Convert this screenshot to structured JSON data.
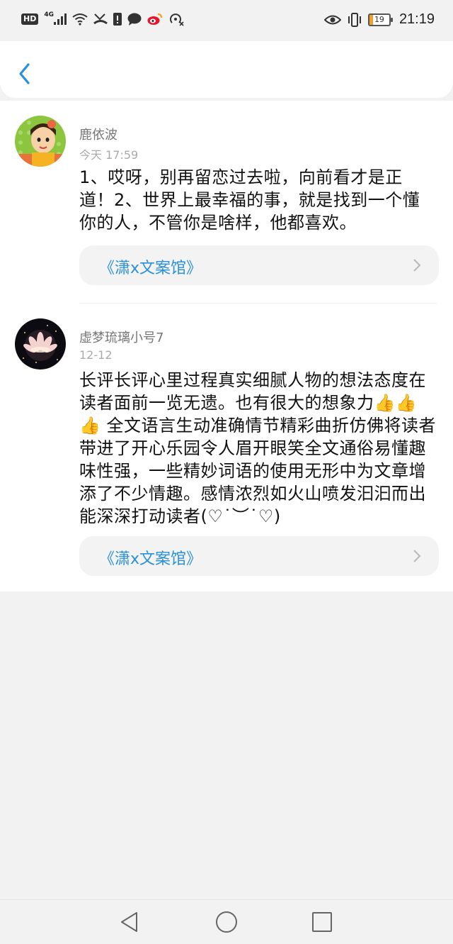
{
  "status_bar": {
    "hd": "HD",
    "network": "4G",
    "battery": "19",
    "battery_level": 0.19,
    "time": "21:19",
    "icons": [
      "hd-icon",
      "signal-icon",
      "wifi-icon",
      "missed-call-icon",
      "alert-icon",
      "message-icon",
      "weibo-icon",
      "hotspot-icon",
      "eye-icon",
      "vibrate-icon",
      "battery-icon"
    ]
  },
  "header": {
    "back_icon": "chevron-left-icon"
  },
  "comments": [
    {
      "name": "鹿依波",
      "time": "今天 17:59",
      "content": "1、哎呀，别再留恋过去啦，向前看才是正道！2、世界上最幸福的事，就是找到一个懂你的人，不管你是啥样，他都喜欢。",
      "book": "《潇x文案馆》"
    },
    {
      "name": "虚梦琉璃小号7",
      "time": "12-12",
      "content": "长评长评心里过程真实细腻人物的想法态度在读者面前一览无遗。也有很大的想象力👍👍👍 全文语言生动准确情节精彩曲折仿佛将读者带进了开心乐园令人眉开眼笑全文通俗易懂趣味性强，一些精妙词语的使用无形中为文章增添了不少情趣。感情浓烈如火山喷发汩汩而出能深深打动读者(♡˙︶˙♡)",
      "book": "《潇x文案馆》"
    }
  ],
  "colors": {
    "accent": "#2a90d9",
    "link_bg": "#f3f3f3",
    "page_bg": "#f2f2f2"
  },
  "nav_bar": {
    "icons": [
      "back-triangle-icon",
      "home-circle-icon",
      "recents-square-icon"
    ]
  }
}
